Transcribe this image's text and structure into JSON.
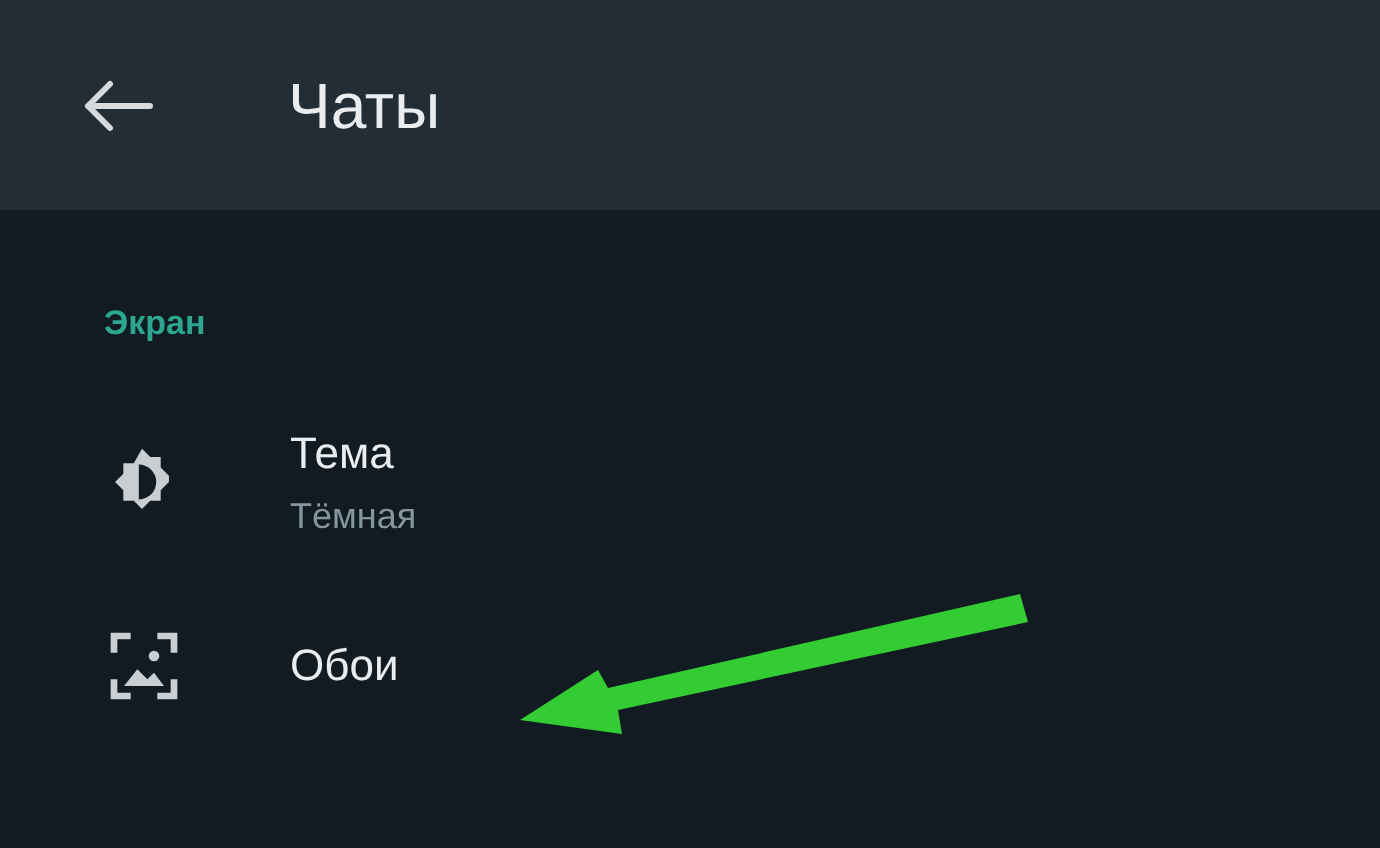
{
  "header": {
    "title": "Чаты"
  },
  "section": {
    "title": "Экран"
  },
  "items": [
    {
      "title": "Тема",
      "subtitle": "Тёмная"
    },
    {
      "title": "Обои"
    }
  ]
}
